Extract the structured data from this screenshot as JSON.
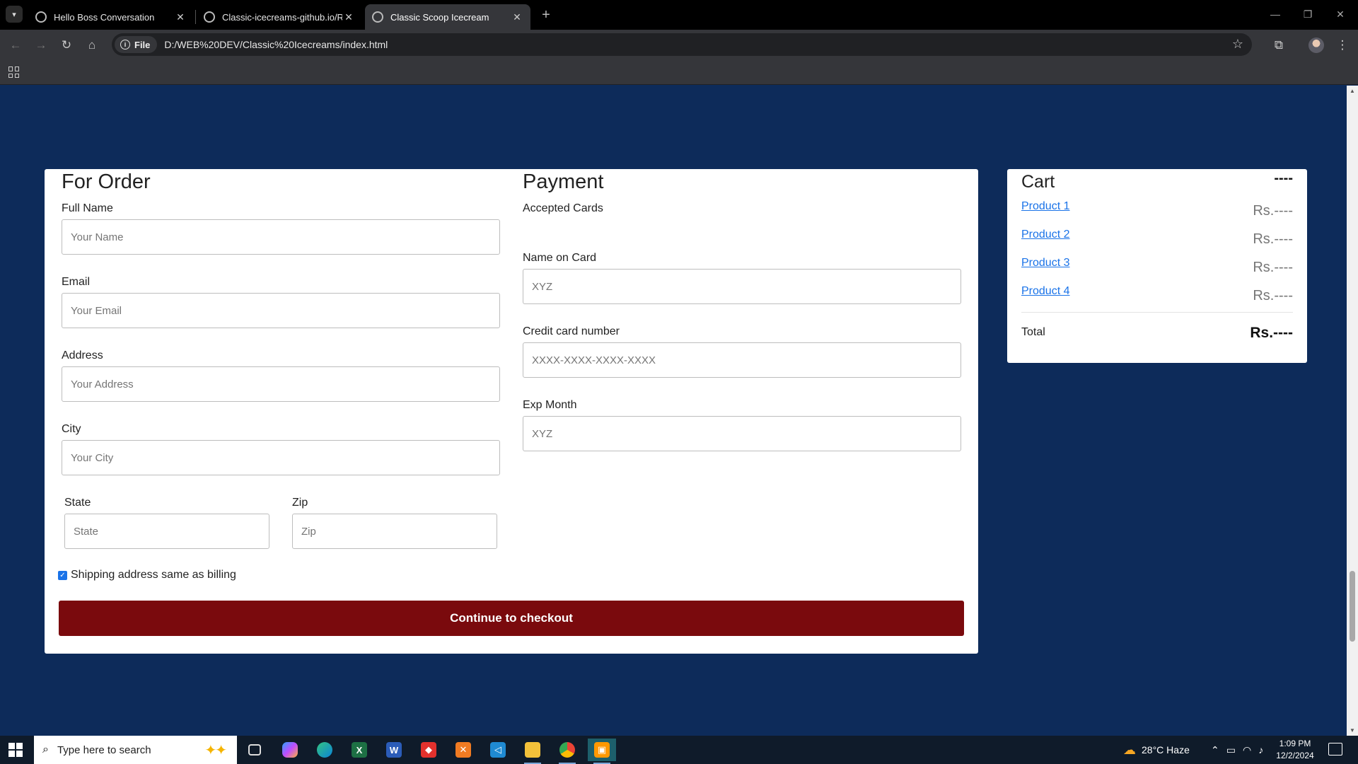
{
  "browser": {
    "tabs": [
      {
        "title": "Hello Boss Conversation",
        "active": false
      },
      {
        "title": "Classic-icecreams-github.io/RE",
        "active": false
      },
      {
        "title": "Classic Scoop Icecream",
        "active": true
      }
    ],
    "new_tab": "+",
    "close_glyph": "✕",
    "url_chip": "File",
    "url": "D:/WEB%20DEV/Classic%20Icecreams/index.html"
  },
  "order_form": {
    "title": "For Order",
    "fields": [
      {
        "label": "Full Name",
        "placeholder": "Your Name"
      },
      {
        "label": "Email",
        "placeholder": "Your Email"
      },
      {
        "label": "Address",
        "placeholder": "Your Address"
      },
      {
        "label": "City",
        "placeholder": "Your City"
      }
    ],
    "state": {
      "label": "State",
      "placeholder": "State"
    },
    "zip": {
      "label": "Zip",
      "placeholder": "Zip"
    },
    "shipping_checkbox": {
      "label": "Shipping address same as billing",
      "checked": true
    }
  },
  "payment": {
    "title": "Payment",
    "accepted_cards_label": "Accepted Cards",
    "fields": [
      {
        "label": "Name on Card",
        "placeholder": "XYZ"
      },
      {
        "label": "Credit card number",
        "placeholder": "XXXX-XXXX-XXXX-XXXX"
      },
      {
        "label": "Exp Month",
        "placeholder": "XYZ"
      }
    ]
  },
  "checkout_button": "Continue to checkout",
  "cart": {
    "title": "Cart",
    "quantity": "----",
    "items": [
      {
        "name": "Product 1",
        "price": "Rs.----"
      },
      {
        "name": "Product 2",
        "price": "Rs.----"
      },
      {
        "name": "Product 3",
        "price": "Rs.----"
      },
      {
        "name": "Product 4",
        "price": "Rs.----"
      }
    ],
    "total_label": "Total",
    "total_price": "Rs.----"
  },
  "taskbar": {
    "search_placeholder": "Type here to search",
    "weather": "28°C  Haze",
    "time": "1:09 PM",
    "date": "12/2/2024"
  },
  "colors": {
    "page_background": "#0d2b5a",
    "checkout_button": "#7a0a0d",
    "link": "#1a73e8"
  }
}
